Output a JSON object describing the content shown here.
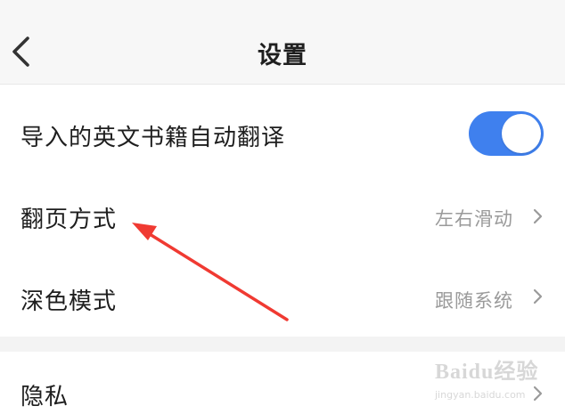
{
  "header": {
    "title": "设置",
    "back_icon": "chevron-left-icon"
  },
  "settings": {
    "auto_translate": {
      "label": "导入的英文书籍自动翻译",
      "enabled": true
    },
    "page_turn": {
      "label": "翻页方式",
      "value": "左右滑动"
    },
    "dark_mode": {
      "label": "深色模式",
      "value": "跟随系统"
    },
    "privacy": {
      "label": "隐私"
    }
  },
  "colors": {
    "accent": "#3f80ee",
    "annotation": "#f03a32",
    "header_bg": "#f7f7f7",
    "value_text": "#9a9a9a"
  },
  "watermark": {
    "line1": "Baidu经验",
    "line2": "jingyan.baidu.com"
  }
}
